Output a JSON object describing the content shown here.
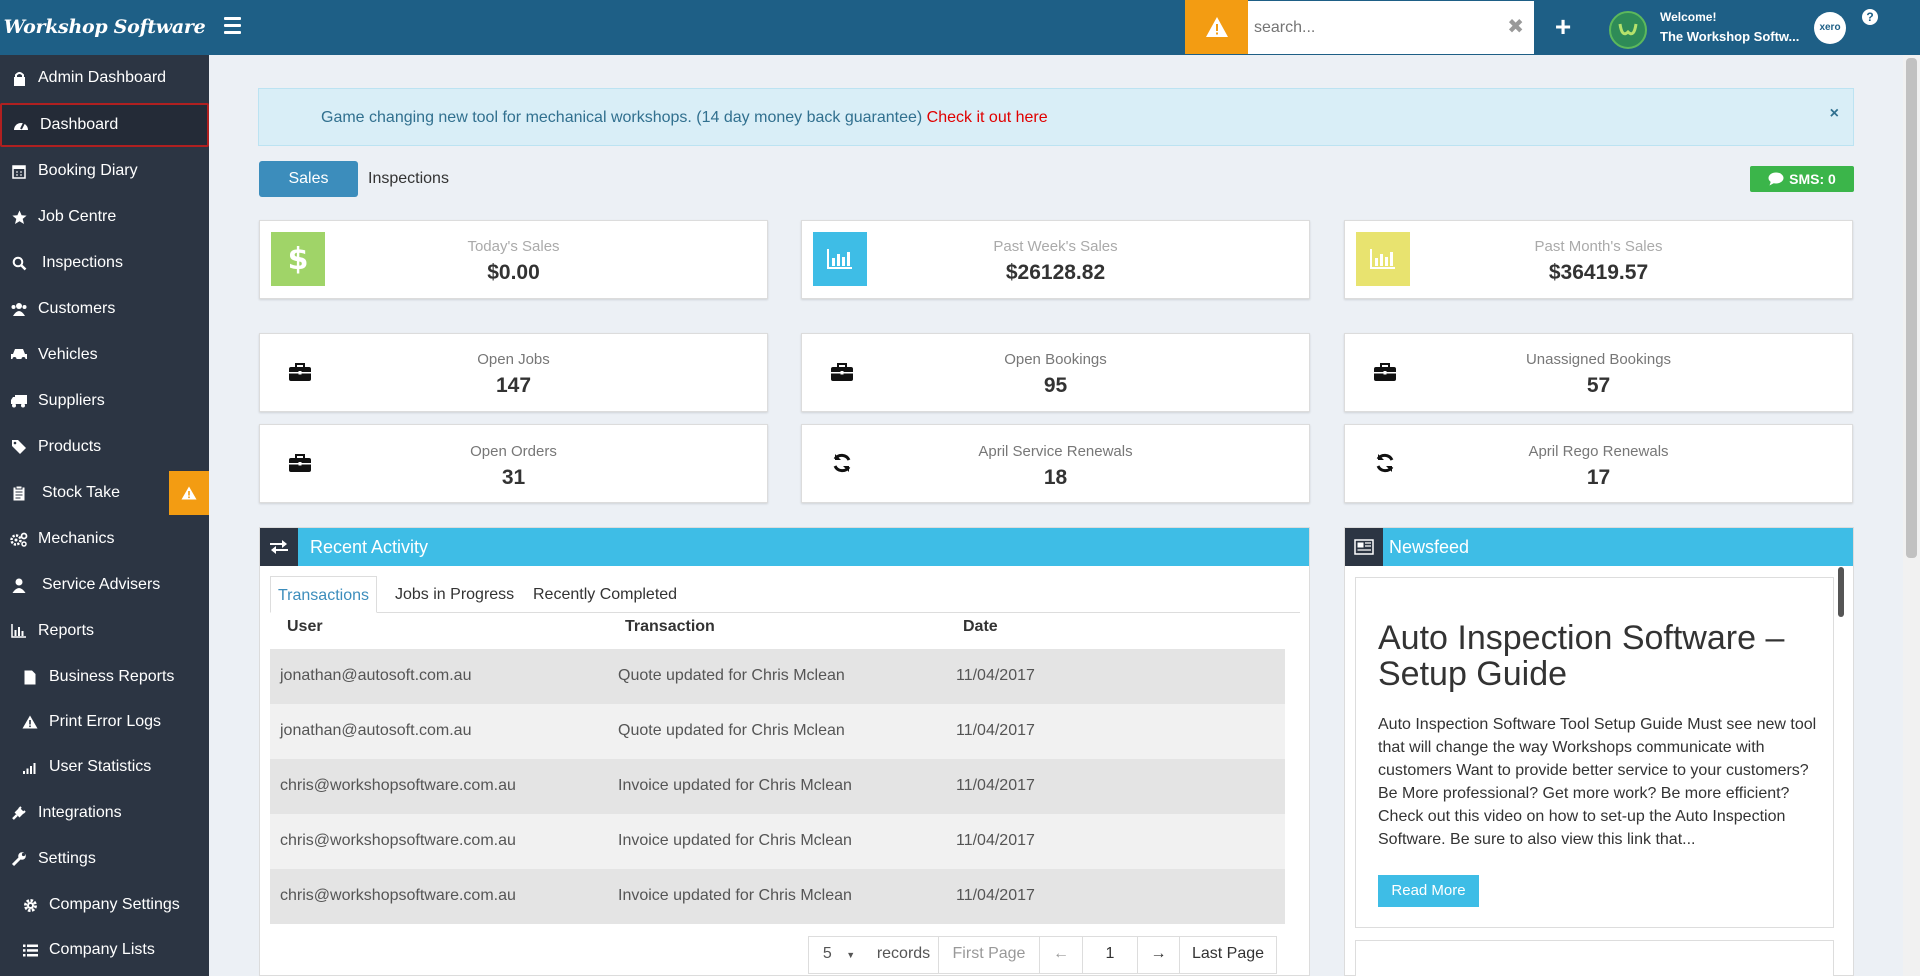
{
  "app": {
    "logo": "Workshop Software"
  },
  "topbar": {
    "search_placeholder": "search...",
    "welcome_line1": "Welcome!",
    "welcome_line2": "The Workshop Softw...",
    "xero_label": "xero",
    "help_label": "?"
  },
  "sidebar": {
    "items": [
      {
        "label": "Admin Dashboard",
        "icon": "lock-icon"
      },
      {
        "label": "Dashboard",
        "icon": "dashboard-icon"
      },
      {
        "label": "Booking Diary",
        "icon": "calendar-icon"
      },
      {
        "label": "Job Centre",
        "icon": "star-icon"
      },
      {
        "label": "Inspections",
        "icon": "search-icon"
      },
      {
        "label": "Customers",
        "icon": "users-icon"
      },
      {
        "label": "Vehicles",
        "icon": "car-icon"
      },
      {
        "label": "Suppliers",
        "icon": "truck-icon"
      },
      {
        "label": "Products",
        "icon": "tags-icon"
      },
      {
        "label": "Stock Take",
        "icon": "clipboard-icon"
      },
      {
        "label": "Mechanics",
        "icon": "cogs-icon"
      },
      {
        "label": "Service Advisers",
        "icon": "user-icon"
      },
      {
        "label": "Reports",
        "icon": "bar-chart-icon"
      },
      {
        "label": "Business Reports",
        "icon": "file-icon"
      },
      {
        "label": "Print Error Logs",
        "icon": "warning-icon"
      },
      {
        "label": "User Statistics",
        "icon": "signal-icon"
      },
      {
        "label": "Integrations",
        "icon": "plug-icon"
      },
      {
        "label": "Settings",
        "icon": "wrench-icon"
      },
      {
        "label": "Company Settings",
        "icon": "gear-icon"
      },
      {
        "label": "Company Lists",
        "icon": "list-icon"
      }
    ]
  },
  "alert": {
    "text": "Game changing new tool for mechanical workshops. (14 day money back guarantee)",
    "link": "Check it out here",
    "close": "×"
  },
  "tabs": {
    "sales": "Sales",
    "inspections": "Inspections"
  },
  "sms": "SMS: 0",
  "stats": {
    "today_title": "Today's Sales",
    "today_value": "$0.00",
    "week_title": "Past Week's Sales",
    "week_value": "$26128.82",
    "month_title": "Past Month's Sales",
    "month_value": "$36419.57",
    "open_jobs_title": "Open Jobs",
    "open_jobs_value": "147",
    "open_bookings_title": "Open Bookings",
    "open_bookings_value": "95",
    "unassigned_title": "Unassigned Bookings",
    "unassigned_value": "57",
    "open_orders_title": "Open Orders",
    "open_orders_value": "31",
    "service_title": "April Service Renewals",
    "service_value": "18",
    "rego_title": "April Rego Renewals",
    "rego_value": "17"
  },
  "colors": {
    "today": "#a0d468",
    "week": "#3ebde6",
    "month": "#e8e36f",
    "accent": "#3c8dbc",
    "panel_head": "#3ebde6",
    "sms": "#3bb54a",
    "warning": "#f39c12"
  },
  "activity": {
    "title": "Recent Activity",
    "subtabs": [
      "Transactions",
      "Jobs in Progress",
      "Recently Completed"
    ],
    "columns": [
      "User",
      "Transaction",
      "Date"
    ],
    "rows": [
      [
        "jonathan@autosoft.com.au",
        "Quote updated for Chris Mclean",
        "11/04/2017"
      ],
      [
        "jonathan@autosoft.com.au",
        "Quote updated for Chris Mclean",
        "11/04/2017"
      ],
      [
        "chris@workshopsoftware.com.au",
        "Invoice updated for Chris Mclean",
        "11/04/2017"
      ],
      [
        "chris@workshopsoftware.com.au",
        "Invoice updated for Chris Mclean",
        "11/04/2017"
      ],
      [
        "chris@workshopsoftware.com.au",
        "Invoice updated for Chris Mclean",
        "11/04/2017"
      ]
    ],
    "pager": {
      "per_page": "5",
      "records": "records",
      "first": "First Page",
      "prev": "←",
      "page": "1",
      "next": "→",
      "last": "Last Page"
    }
  },
  "newsfeed": {
    "title": "Newsfeed",
    "article_title": "Auto Inspection Software – Setup Guide",
    "article_body": "Auto Inspection Software Tool Setup Guide Must see new tool that will change the way Workshops communicate with customers Want to provide better service to your customers? Be More professional? Get more work? Be more efficient? Check out this video on how to set-up the Auto Inspection Software. Be sure to also view this link that...",
    "read_more": "Read More"
  }
}
